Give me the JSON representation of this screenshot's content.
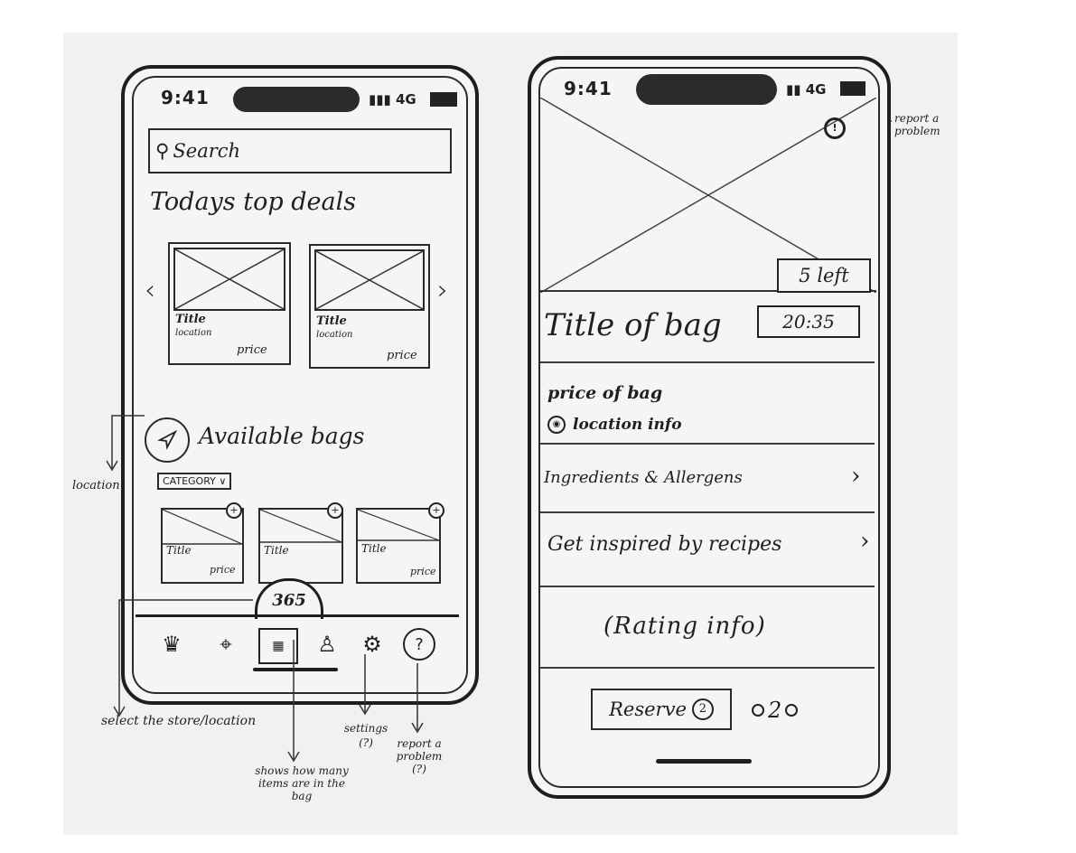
{
  "left_phone": {
    "time": "9:41",
    "network": "4G",
    "search_placeholder": "Search",
    "top_deals_heading": "Todays top deals",
    "deals": [
      {
        "title": "Title",
        "location": "location",
        "price": "price"
      },
      {
        "title": "Title",
        "location": "location",
        "price": "price"
      }
    ],
    "available_heading": "Available bags",
    "category_label": "CATEGORY",
    "bags": [
      {
        "title": "Title",
        "price": "price"
      },
      {
        "title": "Title",
        "price": "price"
      },
      {
        "title": "Title",
        "price": "price"
      }
    ],
    "bag_counter": "365",
    "nav_icons": [
      "crown-icon",
      "map-pin-icon",
      "bag-icon",
      "user-icon",
      "gear-icon",
      "help-icon"
    ]
  },
  "annotations": {
    "location": "location",
    "select_store": "select the store/location",
    "bag_count": "shows how many items are in the bag",
    "settings": "settings (?)",
    "report_problem": "report a problem (?)",
    "report_problem_right": "report a problem"
  },
  "right_phone": {
    "time": "9:41",
    "network": "4G",
    "left_count": "5 left",
    "bag_title": "Title of bag",
    "timer": "20:35",
    "price": "price of bag",
    "location_info": "location info",
    "ingredients": "Ingredients & Allergens",
    "recipes": "Get inspired by recipes",
    "rating": "(Rating info)",
    "reserve_label": "Reserve",
    "reserve_count": "2",
    "stepper_value": "2"
  }
}
